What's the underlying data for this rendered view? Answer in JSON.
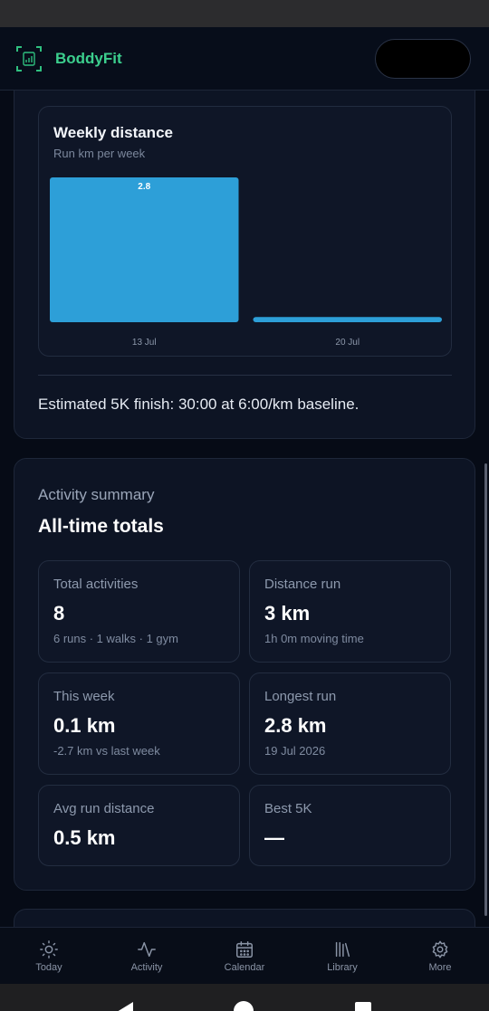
{
  "app": {
    "brand": "BoddyFit"
  },
  "weekly_distance": {
    "title": "Weekly distance",
    "subtitle": "Run km per week",
    "estimate_text": "Estimated 5K finish: 30:00 at 6:00/km baseline."
  },
  "chart_data": {
    "type": "bar",
    "title": "Weekly distance",
    "subtitle": "Run km per week",
    "categories": [
      "13 Jul",
      "20 Jul"
    ],
    "values": [
      2.8,
      0.1
    ],
    "value_labels": [
      "2.8",
      ""
    ],
    "ylim": [
      0,
      2.8
    ],
    "grid": false,
    "bar_color": "#2d9fd8"
  },
  "summary": {
    "label": "Activity summary",
    "title": "All-time totals",
    "tiles": [
      {
        "label": "Total activities",
        "value": "8",
        "sub": "6 runs · 1 walks · 1 gym"
      },
      {
        "label": "Distance run",
        "value": "3 km",
        "sub": "1h 0m moving time"
      },
      {
        "label": "This week",
        "value": "0.1 km",
        "sub": "-2.7 km vs last week"
      },
      {
        "label": "Longest run",
        "value": "2.8 km",
        "sub": "19 Jul 2026"
      },
      {
        "label": "Avg run distance",
        "value": "0.5 km",
        "sub": ""
      },
      {
        "label": "Best 5K",
        "value": "—",
        "sub": ""
      }
    ]
  },
  "nav": {
    "items": [
      {
        "label": "Today",
        "icon": "sun-icon"
      },
      {
        "label": "Activity",
        "icon": "activity-icon"
      },
      {
        "label": "Calendar",
        "icon": "calendar-icon"
      },
      {
        "label": "Library",
        "icon": "library-icon"
      },
      {
        "label": "More",
        "icon": "gear-icon"
      }
    ]
  },
  "colors": {
    "brand": "#3ccf8e",
    "accent_bar": "#2d9fd8",
    "background": "#060b16",
    "card": "#0d1424"
  }
}
